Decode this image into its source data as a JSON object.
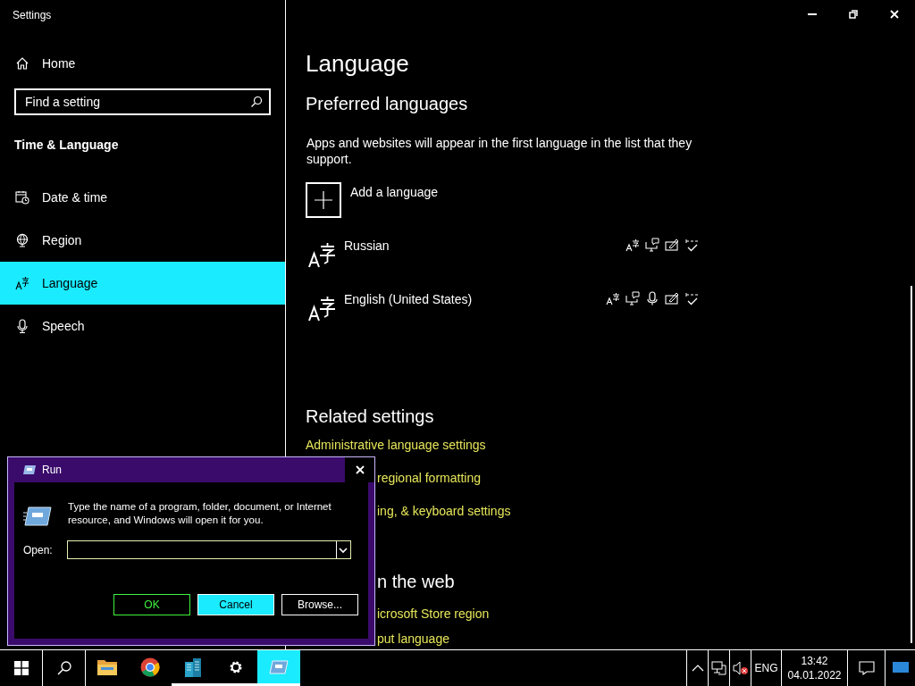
{
  "window": {
    "title": "Settings"
  },
  "sidebar": {
    "home": "Home",
    "search": {
      "placeholder": "Find a setting"
    },
    "section": "Time & Language",
    "items": [
      {
        "label": "Date & time",
        "kind": "clock",
        "selected": false
      },
      {
        "label": "Region",
        "kind": "globe",
        "selected": false
      },
      {
        "label": "Language",
        "kind": "language",
        "selected": true
      },
      {
        "label": "Speech",
        "kind": "mic",
        "selected": false
      }
    ]
  },
  "page": {
    "title": "Language",
    "preferred": {
      "heading": "Preferred languages",
      "description": "Apps and websites will appear in the first language in the list that they support.",
      "add": "Add a language",
      "languages": [
        {
          "name": "Russian",
          "features": [
            {
              "kind": "pack"
            },
            {
              "kind": "display"
            },
            {
              "kind": "handwriting"
            },
            {
              "kind": "spelling"
            }
          ]
        },
        {
          "name": "English (United States)",
          "features": [
            {
              "kind": "pack"
            },
            {
              "kind": "display"
            },
            {
              "kind": "speech"
            },
            {
              "kind": "handwriting"
            },
            {
              "kind": "spelling"
            }
          ]
        }
      ]
    },
    "related": {
      "heading": "Related settings",
      "links": [
        "Administrative language settings",
        "regional formatting",
        "ing, & keyboard settings"
      ]
    },
    "web": {
      "heading": "n the web",
      "links": [
        "icrosoft Store region",
        "put language"
      ]
    }
  },
  "run_dialog": {
    "title": "Run",
    "message": "Type the name of a program, folder, document, or Internet resource, and Windows will open it for you.",
    "open_label": "Open:",
    "buttons": [
      {
        "label": "OK",
        "disabled": true,
        "highlighted": false
      },
      {
        "label": "Cancel",
        "disabled": false,
        "highlighted": true
      },
      {
        "label": "Browse...",
        "disabled": false,
        "highlighted": false
      }
    ]
  },
  "taskbar": {
    "apps": [
      {
        "kind": "folder",
        "running": false,
        "selected": false
      },
      {
        "kind": "browser",
        "running": false,
        "selected": false
      },
      {
        "kind": "buildings",
        "running": true,
        "selected": false
      },
      {
        "kind": "gear",
        "running": true,
        "selected": false
      },
      {
        "kind": "run",
        "running": true,
        "selected": true
      }
    ],
    "language": "ENG",
    "time": "13:42",
    "date": "04.01.2022"
  }
}
